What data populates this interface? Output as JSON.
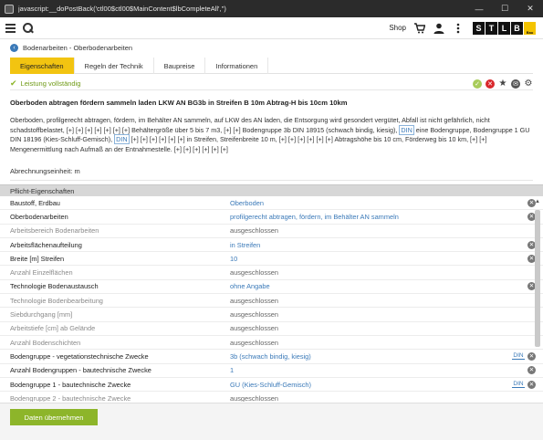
{
  "window": {
    "title": "javascript:__doPostBack('ctl00$ctl00$MainContent$lbCompleteAll','')",
    "minimize": "—",
    "maximize": "☐",
    "close": "✕"
  },
  "appbar": {
    "shop_label": "Shop",
    "logo_letters": [
      "S",
      "T",
      "L",
      "B",
      "Bau"
    ]
  },
  "breadcrumb": {
    "text": "Bodenarbeiten - Oberbodenarbeiten"
  },
  "tabs": [
    {
      "label": "Eigenschaften",
      "active": true
    },
    {
      "label": "Regeln der Technik",
      "active": false
    },
    {
      "label": "Baupreise",
      "active": false
    },
    {
      "label": "Informationen",
      "active": false
    }
  ],
  "status": {
    "text": "Leistung vollständig"
  },
  "heading": "Oberboden abtragen fördern sammeln laden LKW AN BG3b in Streifen B 10m Abtrag-H bis 10cm 10km",
  "description": {
    "p1": "Oberboden, profilgerecht abtragen, fördern, im Behälter AN sammeln, auf LKW des AN laden, die Entsorgung wird gesondert vergütet, Abfall ist nicht gefährlich, nicht schadstoffbelastet, [+] [+] [+] [+] [+] [+] [+] Behältergröße über 5 bis 7 m3, [+] [+] Bodengruppe 3b DIN 18915 (schwach bindig, kiesig),",
    "din1": "DIN",
    "p2": "eine Bodengruppe, Bodengruppe 1 GU DIN 18196 (Kies-Schluff-Gemisch),",
    "din2": "DIN",
    "p3": "[+] [+] [+] [+] [+] [+] in Streifen, Streifenbreite 10 m, [+] [+] [+] [+] [+] [+] Abtragshöhe bis 10 cm, Förderweg bis 10 km, [+] [+] Mengenermittlung nach Aufmaß an der Entnahmestelle. [+] [+] [+] [+] [+] [+]"
  },
  "unit": "Abrechnungseinheit: m",
  "properties": {
    "header": "Pflicht-Eigenschaften",
    "rows": [
      {
        "label": "Baustoff, Erdbau",
        "value": "Oberboden",
        "disabled": false,
        "din": "",
        "clear": true
      },
      {
        "label": "Oberbodenarbeiten",
        "value": "profilgerecht abtragen, fördern, im Behälter AN sammeln",
        "disabled": false,
        "din": "",
        "clear": true
      },
      {
        "label": "Arbeitsbereich Bodenarbeiten",
        "value": "ausgeschlossen",
        "disabled": true,
        "din": "",
        "clear": false
      },
      {
        "label": "Arbeitsflächenaufteilung",
        "value": "in Streifen",
        "disabled": false,
        "din": "",
        "clear": true
      },
      {
        "label": "Breite [m] Streifen",
        "value": "10",
        "disabled": false,
        "din": "",
        "clear": true
      },
      {
        "label": "Anzahl Einzelflächen",
        "value": "ausgeschlossen",
        "disabled": true,
        "din": "",
        "clear": false
      },
      {
        "label": "Technologie Bodenaustausch",
        "value": "ohne Angabe",
        "disabled": false,
        "din": "",
        "clear": true
      },
      {
        "label": "Technologie Bodenbearbeitung",
        "value": "ausgeschlossen",
        "disabled": true,
        "din": "",
        "clear": false
      },
      {
        "label": "Siebdurchgang [mm]",
        "value": "ausgeschlossen",
        "disabled": true,
        "din": "",
        "clear": false
      },
      {
        "label": "Arbeitstiefe [cm] ab Gelände",
        "value": "ausgeschlossen",
        "disabled": true,
        "din": "",
        "clear": false
      },
      {
        "label": "Anzahl Bodenschichten",
        "value": "ausgeschlossen",
        "disabled": true,
        "din": "",
        "clear": false
      },
      {
        "label": "Bodengruppe - vegetationstechnische Zwecke",
        "value": "3b (schwach bindig, kiesig)",
        "disabled": false,
        "din": "DIN",
        "clear": true
      },
      {
        "label": "Anzahl Bodengruppen - bautechnische Zwecke",
        "value": "1",
        "disabled": false,
        "din": "",
        "clear": true
      },
      {
        "label": "Bodengruppe 1 - bautechnische Zwecke",
        "value": "GU (Kies-Schluff-Gemisch)",
        "disabled": false,
        "din": "DIN",
        "clear": true
      },
      {
        "label": "Bodengruppe 2 - bautechnische Zwecke",
        "value": "ausgeschlossen",
        "disabled": true,
        "din": "",
        "clear": false
      }
    ]
  },
  "footer": {
    "apply_label": "Daten übernehmen"
  }
}
